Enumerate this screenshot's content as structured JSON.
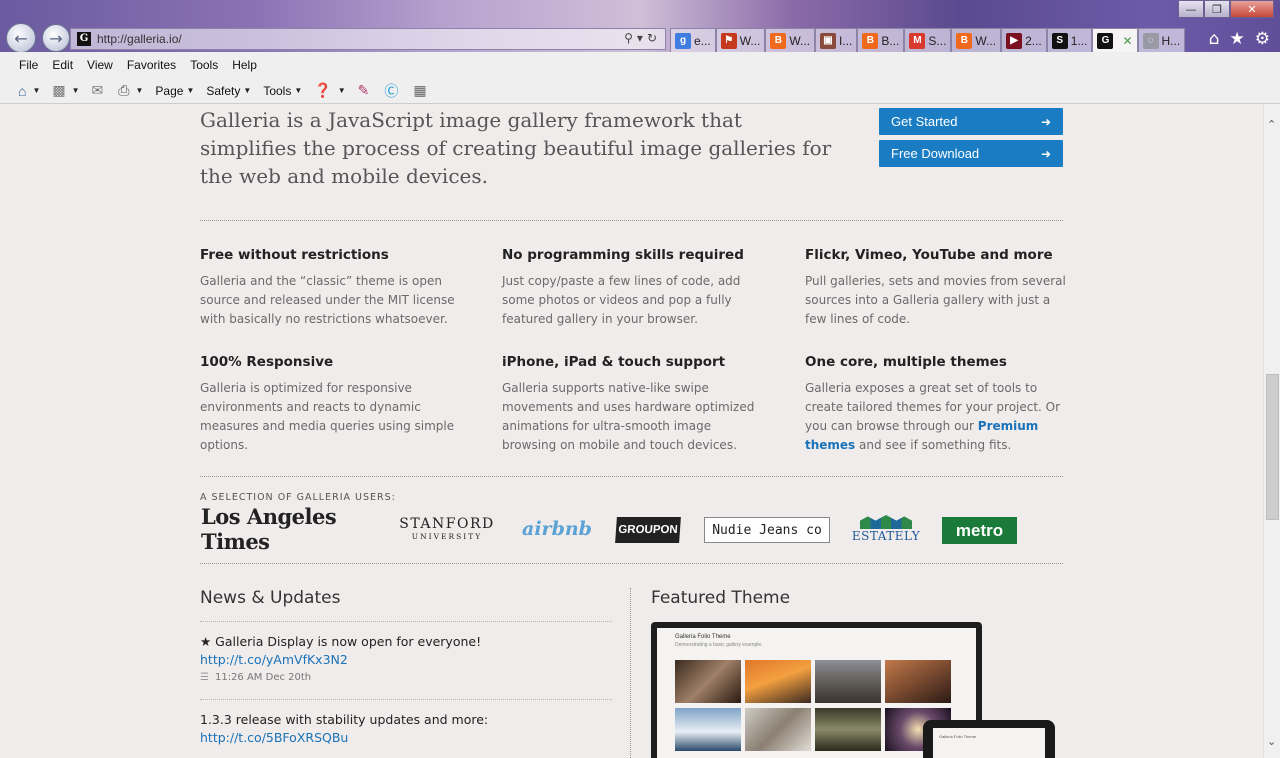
{
  "browser": {
    "url": "http://galleria.io/",
    "tabs": [
      {
        "icon": "google-icon",
        "label": "e...",
        "color": "#3f7de0",
        "glyph": "g"
      },
      {
        "icon": "red-seal-icon",
        "label": "W...",
        "color": "#c53a1f",
        "glyph": "⚑"
      },
      {
        "icon": "blogger-icon",
        "label": "W...",
        "color": "#f06a1d",
        "glyph": "B"
      },
      {
        "icon": "image-favicon-icon",
        "label": "I...",
        "color": "#8a4a3a",
        "glyph": "▣"
      },
      {
        "icon": "blogger-icon",
        "label": "B...",
        "color": "#f06a1d",
        "glyph": "B"
      },
      {
        "icon": "gmail-icon",
        "label": "S...",
        "color": "#d93a2f",
        "glyph": "M"
      },
      {
        "icon": "blogger-icon",
        "label": "W...",
        "color": "#f06a1d",
        "glyph": "B"
      },
      {
        "icon": "video-favicon-icon",
        "label": "2...",
        "color": "#7a1020",
        "glyph": "▶"
      },
      {
        "icon": "s-favicon-icon",
        "label": "1...",
        "color": "#111111",
        "glyph": "S"
      },
      {
        "icon": "galleria-icon",
        "label": "",
        "color": "#111111",
        "glyph": "G",
        "active": true
      },
      {
        "icon": "loading-icon",
        "label": "H...",
        "color": "#9a9aa6",
        "glyph": "◌"
      }
    ],
    "menu": [
      "File",
      "Edit",
      "View",
      "Favorites",
      "Tools",
      "Help"
    ],
    "commands": {
      "page": "Page",
      "safety": "Safety",
      "tools": "Tools"
    }
  },
  "hero": {
    "intro": "Galleria is a JavaScript image gallery framework that simplifies the process of creating beautiful image galleries for the web and mobile devices.",
    "get_started": "Get Started",
    "free_download": "Free Download"
  },
  "features": [
    {
      "title": "Free without restrictions",
      "text": "Galleria and the “classic” theme is open source and released under the MIT license with basically no restrictions whatsoever."
    },
    {
      "title": "No programming skills required",
      "text": "Just copy/paste a few lines of code, add some photos or videos and pop a fully featured gallery in your browser."
    },
    {
      "title": "Flickr, Vimeo, YouTube and more",
      "text": "Pull galleries, sets and movies from several sources into a Galleria gallery with just a few lines of code."
    },
    {
      "title": "100% Responsive",
      "text": "Galleria is optimized for responsive environments and reacts to dynamic measures and media queries using simple options."
    },
    {
      "title": "iPhone, iPad & touch support",
      "text": "Galleria supports native-like swipe movements and uses hardware optimized animations for ultra-smooth image browsing on mobile and touch devices."
    },
    {
      "title": "One core, multiple themes",
      "text_before": "Galleria exposes a great set of tools to create tailored themes for your project. Or you can browse through our ",
      "link": "Premium themes",
      "text_after": " and see if something fits."
    }
  ],
  "users": {
    "title": "A SELECTION OF GALLERIA USERS:",
    "logos": {
      "lat": "Los Angeles Times",
      "stanford_1": "STANFORD",
      "stanford_2": "UNIVERSITY",
      "airbnb": "airbnb",
      "groupon": "GROUPON",
      "nudie": "Nudie Jeans co",
      "estately": "ESTATELY",
      "metro": "metro"
    }
  },
  "news": {
    "title": "News & Updates",
    "items": [
      {
        "text": "★ Galleria Display is now open for everyone!",
        "link": "http://t.co/yAmVfKx3N2",
        "time": "11:26 AM Dec 20th"
      },
      {
        "text": "1.3.3 release with stability updates and more:",
        "link": "http://t.co/5BFoXRSQBu",
        "time": ""
      }
    ]
  },
  "featured": {
    "title": "Featured Theme",
    "mock_title": "Galleria Folio Theme",
    "mock_subtitle": "Demonstrating a basic gallery example."
  }
}
